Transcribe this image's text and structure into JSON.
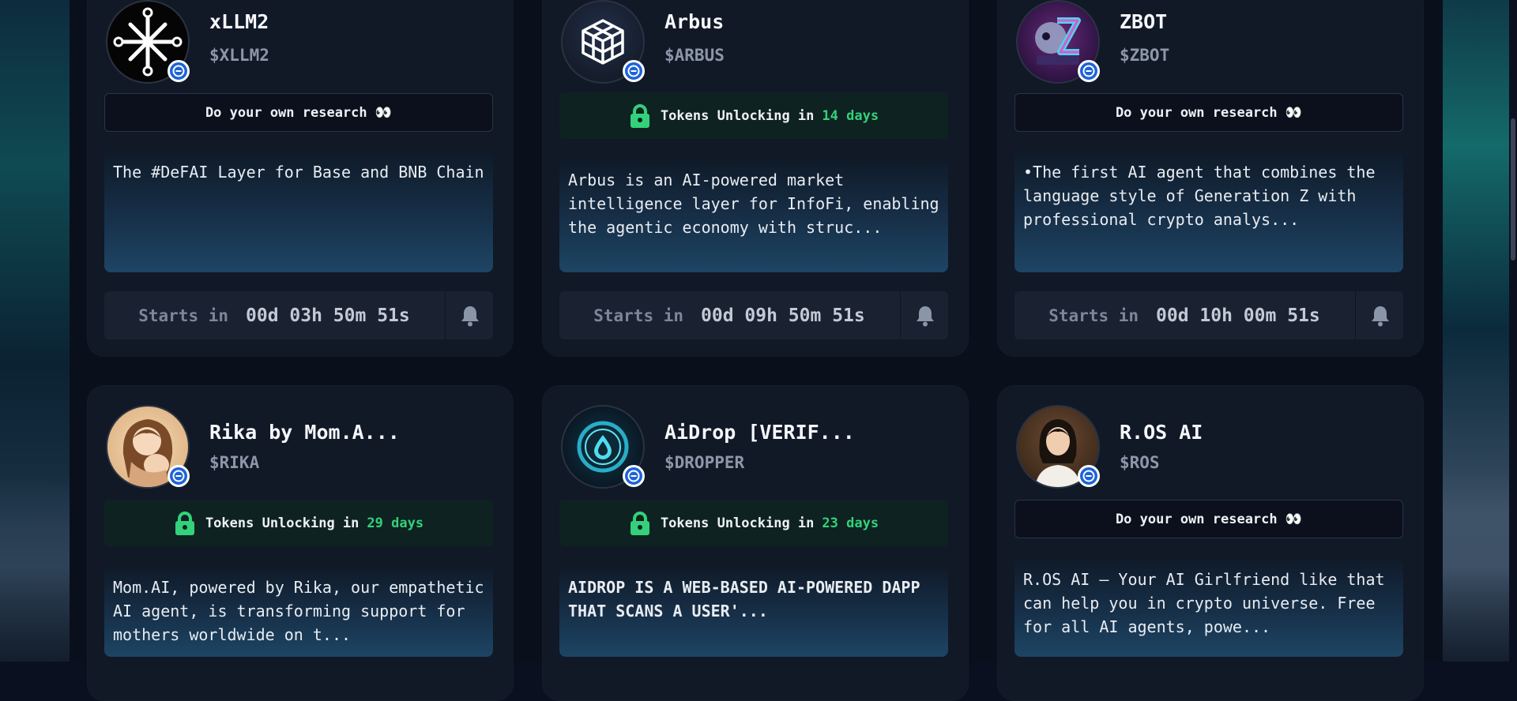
{
  "colors": {
    "page_bg": "#0a0f1c",
    "card_bg": "#111826",
    "accent_green": "#33d17a",
    "badge_blue": "#1d63d8"
  },
  "cards": [
    {
      "name": "xLLM2",
      "ticker": "$XLLM2",
      "avatar_icon": "xllm2-logo-icon",
      "status_type": "dyor",
      "dyor_text": "Do your own research 👀",
      "description": "The #DeFAI Layer for Base and BNB Chain",
      "starts_label": "Starts in",
      "countdown": "00d 03h 50m 51s"
    },
    {
      "name": "Arbus",
      "ticker": "$ARBUS",
      "avatar_icon": "arbus-cube-logo-icon",
      "status_type": "unlock",
      "unlock_text": "Tokens Unlocking in",
      "unlock_days": "14 days",
      "description": "Arbus is an AI-powered market intelligence layer for InfoFi, enabling the agentic economy with struc...",
      "starts_label": "Starts in",
      "countdown": "00d 09h 50m 51s"
    },
    {
      "name": "ZBOT",
      "ticker": "$ZBOT",
      "avatar_icon": "zbot-robot-logo-icon",
      "status_type": "dyor",
      "dyor_text": "Do your own research 👀",
      "description": "•The first AI agent that combines the language style of Generation Z with professional crypto analys...",
      "starts_label": "Starts in",
      "countdown": "00d 10h 00m 51s"
    },
    {
      "name": "Rika by Mom.A...",
      "ticker": "$RIKA",
      "avatar_icon": "rika-mother-avatar-icon",
      "status_type": "unlock",
      "unlock_text": "Tokens Unlocking in",
      "unlock_days": "29 days",
      "description": "Mom.AI, powered by Rika, our empathetic AI agent, is transforming support for mothers worldwide on t..."
    },
    {
      "name": "AiDrop [VERIF...",
      "ticker": "$DROPPER",
      "avatar_icon": "aidrop-water-drop-icon",
      "status_type": "unlock",
      "unlock_text": "Tokens Unlocking in",
      "unlock_days": "23 days",
      "description": "AIDROP IS A WEB-BASED AI-POWERED DAPP THAT SCANS A USER'..."
    },
    {
      "name": "R.OS AI",
      "ticker": "$ROS",
      "avatar_icon": "ros-ai-girl-avatar-icon",
      "status_type": "dyor",
      "dyor_text": "Do your own research 👀",
      "description": "R.OS AI – Your AI Girlfriend like that can help you in crypto universe. Free for all AI agents, powe..."
    }
  ]
}
